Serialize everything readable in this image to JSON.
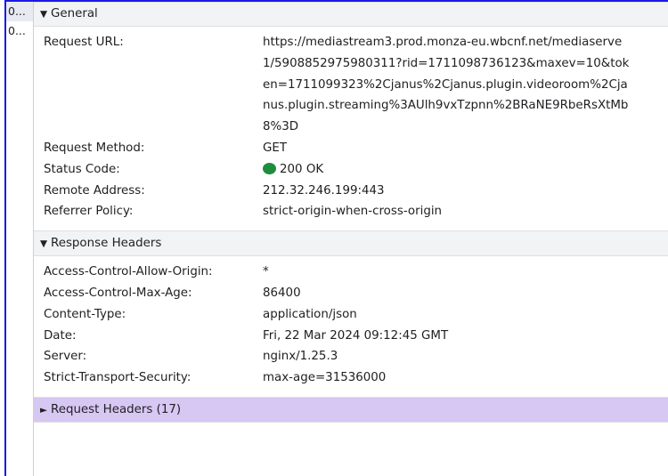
{
  "name_column": [
    "0...",
    "0..."
  ],
  "general": {
    "title": "General",
    "request_url_key": "Request URL:",
    "request_url_lines": [
      "https://mediastream3.prod.monza-eu.wbcnf.net/mediaserve",
      "1/5908852975980311?rid=1711098736123&maxev=10&tok",
      "en=1711099323%2Cjanus%2Cjanus.plugin.videoroom%2Cja",
      "nus.plugin.streaming%3AUlh9vxTzpnn%2BRaNE9RbeRsXtMb",
      "8%3D"
    ],
    "method_key": "Request Method:",
    "method_val": "GET",
    "status_key": "Status Code:",
    "status_val": "200 OK",
    "status_color": "#1e8e3e",
    "remote_key": "Remote Address:",
    "remote_val": "212.32.246.199:443",
    "referrer_key": "Referrer Policy:",
    "referrer_val": "strict-origin-when-cross-origin"
  },
  "response_headers": {
    "title": "Response Headers",
    "rows": [
      {
        "key": "Access-Control-Allow-Origin:",
        "val": "*"
      },
      {
        "key": "Access-Control-Max-Age:",
        "val": "86400"
      },
      {
        "key": "Content-Type:",
        "val": "application/json"
      },
      {
        "key": "Date:",
        "val": "Fri, 22 Mar 2024 09:12:45 GMT"
      },
      {
        "key": "Server:",
        "val": "nginx/1.25.3"
      },
      {
        "key": "Strict-Transport-Security:",
        "val": "max-age=31536000"
      }
    ]
  },
  "request_headers": {
    "title": "Request Headers (17)"
  },
  "icons": {
    "expanded": "▼",
    "collapsed": "►"
  },
  "colors": {
    "frame": "#1a1ae6",
    "section_bg": "#f1f3f4",
    "collapsed_section_bg": "#d7c7f3"
  }
}
